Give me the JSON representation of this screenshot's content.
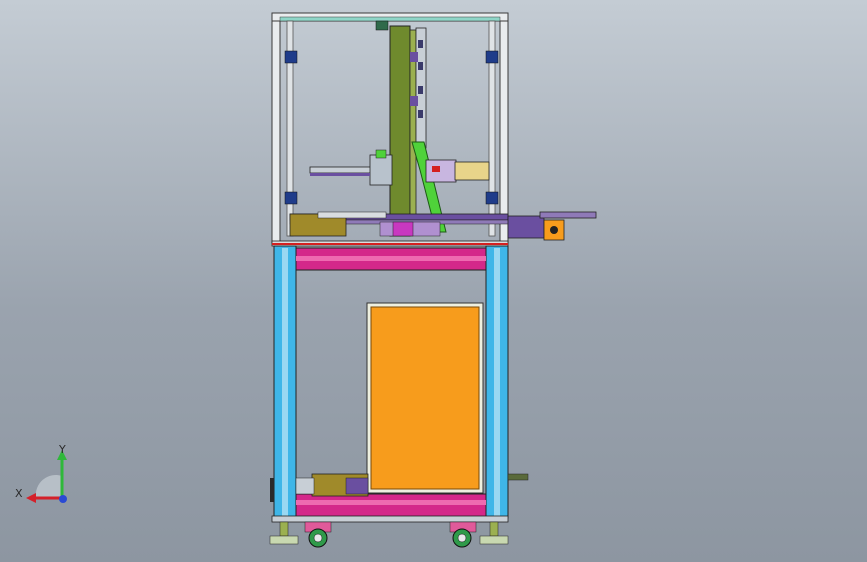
{
  "viewport": {
    "background_top": "#c4ccd4",
    "background_bottom": "#8d96a1"
  },
  "model": {
    "colors": {
      "frame_silver": "#dfe3e6",
      "frame_blue": "#3fb6e8",
      "beam_magenta": "#d4288a",
      "panel_orange": "#f79c1c",
      "column_green": "#6f8a2d",
      "bracket_green": "#4fd23a",
      "rail_purple": "#6a4fa0",
      "motor_olive": "#a08a2a",
      "block_khaki": "#e8d48a",
      "wheel_pink": "#e05a9a",
      "wheel_green": "#2f9a4a"
    }
  },
  "triad": {
    "x_label": "X",
    "y_label": "Y",
    "x_color": "#d4202a",
    "y_color": "#2fb83a",
    "z_color": "#2a4ad4"
  }
}
